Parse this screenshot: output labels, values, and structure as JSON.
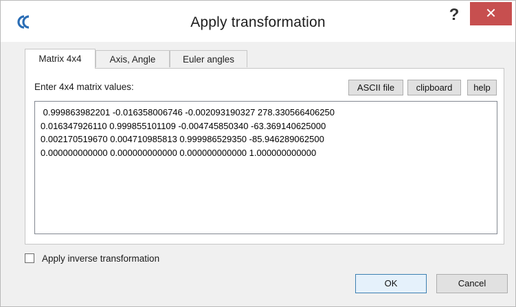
{
  "window": {
    "title": "Apply transformation",
    "app_icon": "cloudcompare-logo-icon",
    "help_symbol": "?",
    "close_symbol": "✕"
  },
  "tabs": [
    {
      "label": "Matrix 4x4",
      "active": true
    },
    {
      "label": "Axis, Angle",
      "active": false
    },
    {
      "label": "Euler angles",
      "active": false
    }
  ],
  "matrix_tab": {
    "label": "Enter 4x4 matrix values:",
    "buttons": {
      "ascii_file": "ASCII file",
      "clipboard": "clipboard",
      "help": "help"
    },
    "matrix_text": " 0.999863982201 -0.016358006746 -0.002093190327 278.330566406250\n0.016347926110 0.999855101109 -0.004745850340 -63.369140625000\n0.002170519670 0.004710985813 0.999986529350 -85.946289062500\n0.000000000000 0.000000000000 0.000000000000 1.000000000000"
  },
  "inverse_checkbox": {
    "label": "Apply inverse transformation",
    "checked": false
  },
  "footer": {
    "ok": "OK",
    "cancel": "Cancel"
  },
  "colors": {
    "close_button": "#c74f4f",
    "ok_border": "#3c7fb1",
    "logo_blue": "#2a6db5"
  }
}
